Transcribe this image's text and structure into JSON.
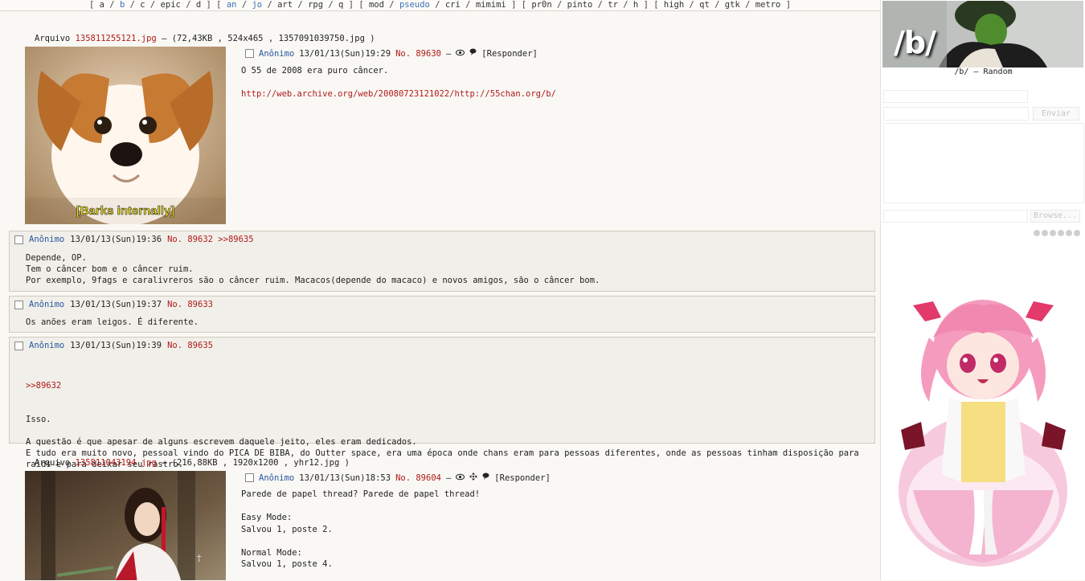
{
  "boardlist": [
    {
      "t": "[",
      "k": "sep"
    },
    {
      "t": "a",
      "k": "link"
    },
    {
      "t": "/",
      "k": "sep"
    },
    {
      "t": "b",
      "k": "hl"
    },
    {
      "t": "/",
      "k": "sep"
    },
    {
      "t": "c",
      "k": "link"
    },
    {
      "t": "/",
      "k": "sep"
    },
    {
      "t": "epic",
      "k": "link"
    },
    {
      "t": "/",
      "k": "sep"
    },
    {
      "t": "d",
      "k": "link"
    },
    {
      "t": "]",
      "k": "sep"
    },
    {
      "t": "[",
      "k": "sep"
    },
    {
      "t": "an",
      "k": "hl"
    },
    {
      "t": "/",
      "k": "sep"
    },
    {
      "t": "jo",
      "k": "hl"
    },
    {
      "t": "/",
      "k": "sep"
    },
    {
      "t": "art",
      "k": "link"
    },
    {
      "t": "/",
      "k": "sep"
    },
    {
      "t": "rpg",
      "k": "link"
    },
    {
      "t": "/",
      "k": "sep"
    },
    {
      "t": "q",
      "k": "link"
    },
    {
      "t": "]",
      "k": "sep"
    },
    {
      "t": "[",
      "k": "sep"
    },
    {
      "t": "mod",
      "k": "link"
    },
    {
      "t": "/",
      "k": "sep"
    },
    {
      "t": "pseudo",
      "k": "hl"
    },
    {
      "t": "/",
      "k": "sep"
    },
    {
      "t": "cri",
      "k": "link"
    },
    {
      "t": "/",
      "k": "sep"
    },
    {
      "t": "mimimi",
      "k": "link"
    },
    {
      "t": "]",
      "k": "sep"
    },
    {
      "t": "[",
      "k": "sep"
    },
    {
      "t": "pr0n",
      "k": "link"
    },
    {
      "t": "/",
      "k": "sep"
    },
    {
      "t": "pinto",
      "k": "link"
    },
    {
      "t": "/",
      "k": "sep"
    },
    {
      "t": "tr",
      "k": "link"
    },
    {
      "t": "/",
      "k": "sep"
    },
    {
      "t": "h",
      "k": "link"
    },
    {
      "t": "]",
      "k": "sep"
    },
    {
      "t": "[",
      "k": "sep"
    },
    {
      "t": "high",
      "k": "link"
    },
    {
      "t": "/",
      "k": "sep"
    },
    {
      "t": "qt",
      "k": "link"
    },
    {
      "t": "/",
      "k": "sep"
    },
    {
      "t": "gtk",
      "k": "link"
    },
    {
      "t": "/",
      "k": "sep"
    },
    {
      "t": "metro",
      "k": "link"
    },
    {
      "t": "]",
      "k": "sep"
    }
  ],
  "thread1": {
    "file_prefix": "Arquivo",
    "file_name": "135811255121.jpg",
    "file_meta": " – (72,43KB , 524x465 , 1357091039750.jpg )",
    "thumb_caption": "[Barks internally]",
    "name": "Anônimo",
    "date": "13/01/13(Sun)19:29",
    "no": "No. 89630",
    "dash": "–",
    "reply_label": "[Responder]",
    "line1": "O 55 de 2008 era puro câncer.",
    "link": "http://web.archive.org/web/20080723121022/http://55chan.org/b/"
  },
  "replies": [
    {
      "name": "Anônimo",
      "date": "13/01/13(Sun)19:36",
      "no": "No. 89632",
      "backlink": ">>89635",
      "body": "Depende, OP.\nTem o câncer bom e o câncer ruim.\nPor exemplo, 9fags e caralivreros são o câncer ruim. Macacos(depende do macaco) e novos amigos, são o câncer bom."
    },
    {
      "name": "Anônimo",
      "date": "13/01/13(Sun)19:37",
      "no": "No. 89633",
      "body": "Os anões eram leigos. É diferente."
    },
    {
      "name": "Anônimo",
      "date": "13/01/13(Sun)19:39",
      "no": "No. 89635",
      "quote": ">>89632",
      "body": "Isso.\n\nA questão é que apesar de alguns escrevem daquele jeito, eles eram dedicados.\nE tudo era muito novo, pessoal vindo do PICA DE BIBA, do Outter space, era uma época onde chans eram para pessoas diferentes, onde as pessoas tinham disposição para\nraids e para deixar seu rastro.\nEra uma época boa."
    }
  ],
  "thread2": {
    "file_prefix": "Arquivo",
    "file_name": "135811043194.jpg",
    "file_meta": " – (216,88KB , 1920x1200 , yhr12.jpg )",
    "name": "Anônimo",
    "date": "13/01/13(Sun)18:53",
    "no": "No. 89604",
    "dash": "–",
    "reply_label": "[Responder]",
    "body": "Parede de papel thread? Parede de papel thread!\n\nEasy Mode:\nSalvou 1, poste 2.\n\nNormal Mode:\nSalvou 1, poste 4."
  },
  "sidebar": {
    "banner_text": "/b/",
    "board_title": "/b/ – Random",
    "submit_label": "Enviar",
    "browse_label": "Browse..."
  },
  "icons": {
    "watch": "eye-icon",
    "expand": "move-icon",
    "quick_reply": "balloon-icon"
  }
}
